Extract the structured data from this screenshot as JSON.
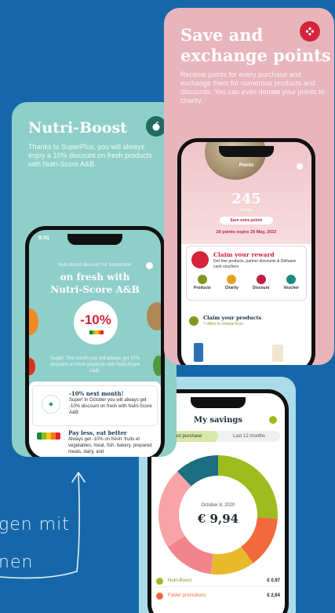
{
  "colors": {
    "background": "#1667a9",
    "green_card": "#8ecfc9",
    "pink_card": "#e8b5bd",
    "blue_card": "#a9dbe8",
    "red": "#d3243b",
    "lime": "#9fbc1e"
  },
  "caption": {
    "line1": "gen mit",
    "line2": "nen"
  },
  "nutri": {
    "title": "Nutri-Boost",
    "description": "Thanks to SuperPlus, you will always enjoy a 10% discount on fresh products with Nutri-Score A&B.",
    "badge_icon": "apple-icon",
    "phone": {
      "time": "9:41",
      "kicker": "Nutri-Boost discount for September",
      "headline1": "on fresh with",
      "headline2": "Nutri-Score A&B",
      "discount": "-10%",
      "body": "Super! This month you will always get 10% discount on fresh products with Nutri-Score A&B.",
      "items": [
        {
          "icon": "sparkle-leaf-icon",
          "title": "-10% next month!",
          "text": "Super! In October you will always get -10% discount on fresh with Nutri-Score A&B"
        },
        {
          "icon": "nutri-score-icon",
          "title": "Pay less, eat better",
          "text": "Always get -10% on fresh: fruits et vegetables, meat, fish, bakery, prepared meals, dairy, and"
        }
      ]
    }
  },
  "save": {
    "title1": "Save and",
    "title2": "exchange points",
    "description": "Receive points for every purchase and exchange them for numerous products and discounts. You can even donate your points to charity.",
    "badge_icon": "dots-flower-icon",
    "phone": {
      "header": "Points",
      "points": "245",
      "points_label": "Points",
      "earn_button": "Earn extra points",
      "expiry": "20 points expire 20 May, 2022",
      "reward_title": "Claim your reward",
      "reward_text": "Get free products, partner discounts & Delhaize cash vouchers",
      "categories": [
        {
          "label": "Products",
          "color": "#7d9a1f",
          "icon": "leaf-icon"
        },
        {
          "label": "Charity",
          "color": "#e5a21d",
          "icon": "heart-hand-icon"
        },
        {
          "label": "Discount",
          "color": "#c51e45",
          "icon": "percent-icon"
        },
        {
          "label": "Voucher",
          "color": "#1a8a86",
          "icon": "euro-icon"
        }
      ],
      "claim_title": "Claim your products",
      "claim_sub": "7 offers to choose from"
    }
  },
  "savings": {
    "phone": {
      "title": "My savings",
      "tabs": [
        "Last purchase",
        "Last 12 months"
      ],
      "date": "October 8, 2020",
      "total": "€ 9,94",
      "rows": [
        {
          "label": "Nutri-Boost",
          "value": "€ 0,97",
          "color": "#9fbc1e"
        },
        {
          "label": "Folder promotions",
          "value": "€ 2,64",
          "color": "#f26a3b"
        }
      ]
    },
    "chart_data": {
      "type": "pie",
      "values": [
        0.26,
        0.14,
        0.12,
        0.14,
        0.22,
        0.12
      ],
      "colors": [
        "#9fbc1e",
        "#f26a3b",
        "#e8b92a",
        "#f2848d",
        "#f7a3a8",
        "#1c6f80"
      ]
    }
  }
}
